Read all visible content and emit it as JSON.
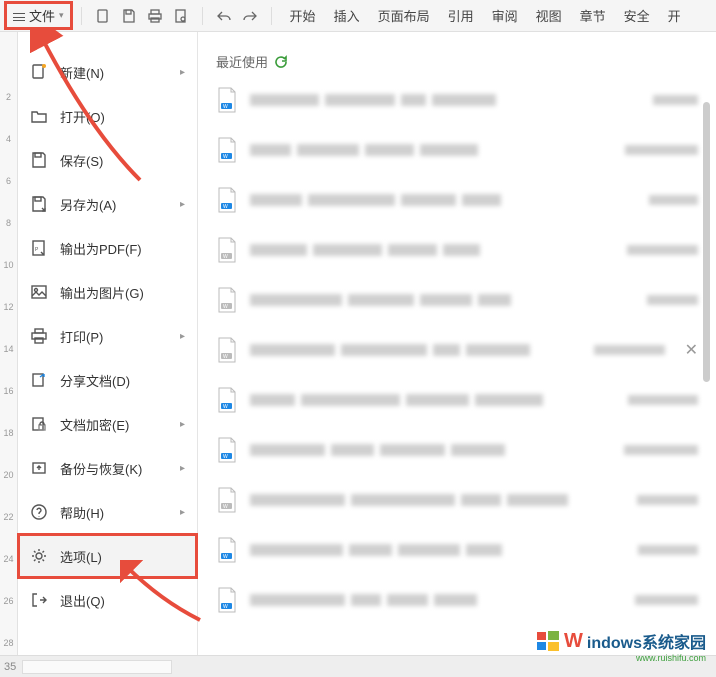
{
  "topbar": {
    "file_label": "文件",
    "tabs": [
      "开始",
      "插入",
      "页面布局",
      "引用",
      "审阅",
      "视图",
      "章节",
      "安全",
      "开"
    ]
  },
  "file_menu": {
    "items": [
      {
        "label": "新建(N)",
        "icon": "new-icon",
        "submenu": true
      },
      {
        "label": "打开(O)",
        "icon": "open-icon",
        "submenu": false
      },
      {
        "label": "保存(S)",
        "icon": "save-icon",
        "submenu": false
      },
      {
        "label": "另存为(A)",
        "icon": "saveas-icon",
        "submenu": true
      },
      {
        "label": "输出为PDF(F)",
        "icon": "pdf-icon",
        "submenu": false
      },
      {
        "label": "输出为图片(G)",
        "icon": "image-icon",
        "submenu": false
      },
      {
        "label": "打印(P)",
        "icon": "print-icon",
        "submenu": true
      },
      {
        "label": "分享文档(D)",
        "icon": "share-icon",
        "submenu": false
      },
      {
        "label": "文档加密(E)",
        "icon": "encrypt-icon",
        "submenu": true
      },
      {
        "label": "备份与恢复(K)",
        "icon": "backup-icon",
        "submenu": true
      },
      {
        "label": "帮助(H)",
        "icon": "help-icon",
        "submenu": true
      },
      {
        "label": "选项(L)",
        "icon": "options-icon",
        "submenu": false,
        "highlight": true
      },
      {
        "label": "退出(Q)",
        "icon": "exit-icon",
        "submenu": false
      }
    ]
  },
  "recent": {
    "header": "最近使用"
  },
  "ruler_numbers": [
    "2",
    "4",
    "6",
    "8",
    "10",
    "12",
    "14",
    "16",
    "18",
    "20",
    "22",
    "24",
    "26",
    "28"
  ],
  "bottom_page": "35",
  "watermark": {
    "text": "indows系统家园",
    "sub": "www.ruishifu.com"
  }
}
